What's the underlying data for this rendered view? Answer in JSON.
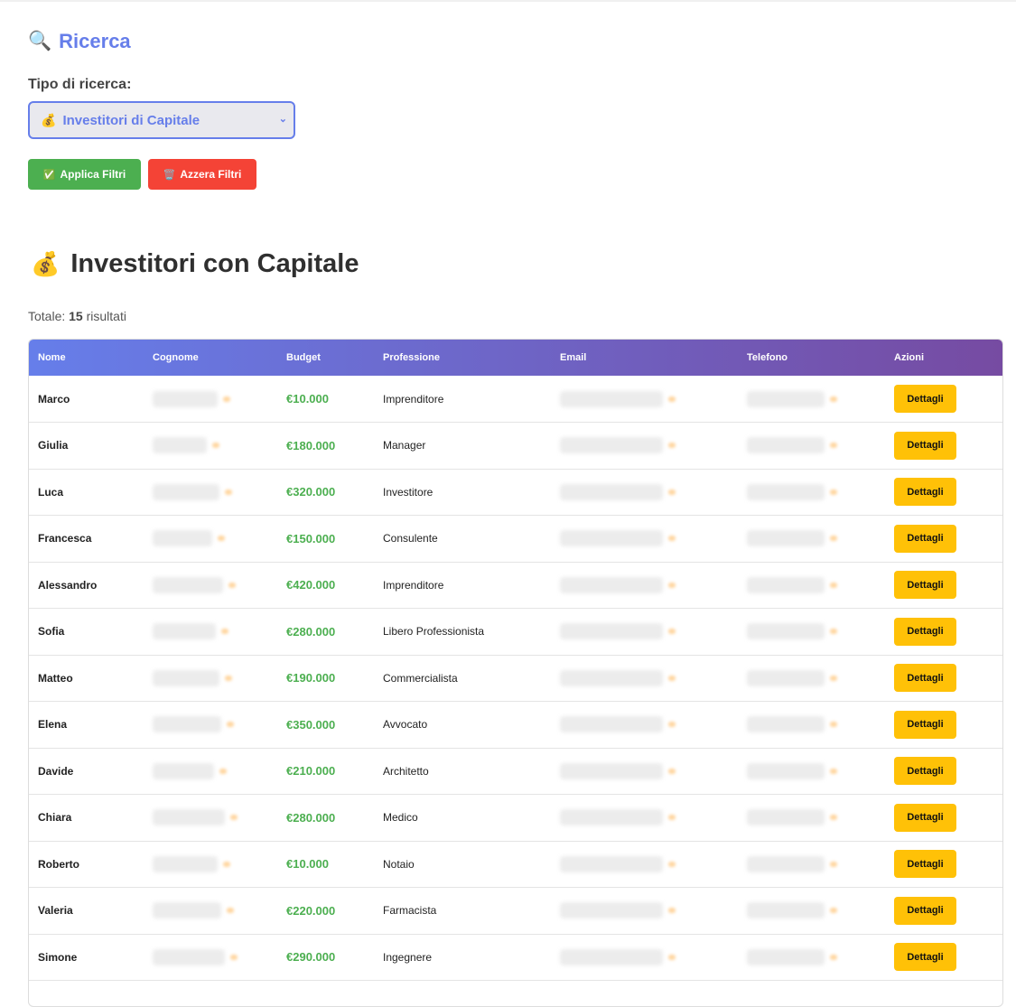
{
  "search": {
    "icon": "magnifier-icon",
    "title": "Ricerca",
    "type_label": "Tipo di ricerca:",
    "selected_option": "Investitori di Capitale",
    "selected_option_icon": "money-bag-icon",
    "apply_label": "Applica Filtri",
    "reset_label": "Azzera Filtri"
  },
  "results": {
    "title": "Investitori con Capitale",
    "title_icon": "money-bag-icon",
    "total_prefix": "Totale:",
    "total_count": "15",
    "total_suffix": "risultati"
  },
  "table": {
    "columns": [
      "Nome",
      "Cognome",
      "Budget",
      "Professione",
      "Email",
      "Telefono",
      "Azioni"
    ],
    "action_label": "Dettagli",
    "rows": [
      {
        "nome": "Marco",
        "budget": "€10.000",
        "professione": "Imprenditore"
      },
      {
        "nome": "Giulia",
        "budget": "€180.000",
        "professione": "Manager"
      },
      {
        "nome": "Luca",
        "budget": "€320.000",
        "professione": "Investitore"
      },
      {
        "nome": "Francesca",
        "budget": "€150.000",
        "professione": "Consulente"
      },
      {
        "nome": "Alessandro",
        "budget": "€420.000",
        "professione": "Imprenditore"
      },
      {
        "nome": "Sofia",
        "budget": "€280.000",
        "professione": "Libero Professionista"
      },
      {
        "nome": "Matteo",
        "budget": "€190.000",
        "professione": "Commercialista"
      },
      {
        "nome": "Elena",
        "budget": "€350.000",
        "professione": "Avvocato"
      },
      {
        "nome": "Davide",
        "budget": "€210.000",
        "professione": "Architetto"
      },
      {
        "nome": "Chiara",
        "budget": "€280.000",
        "professione": "Medico"
      },
      {
        "nome": "Roberto",
        "budget": "€10.000",
        "professione": "Notaio"
      },
      {
        "nome": "Valeria",
        "budget": "€220.000",
        "professione": "Farmacista"
      },
      {
        "nome": "Simone",
        "budget": "€290.000",
        "professione": "Ingegnere"
      }
    ]
  },
  "colors": {
    "accent": "#667eea",
    "header_gradient_end": "#764ba2",
    "apply": "#4caf50",
    "reset": "#f44336",
    "budget": "#4caf50",
    "action": "#ffc107"
  }
}
